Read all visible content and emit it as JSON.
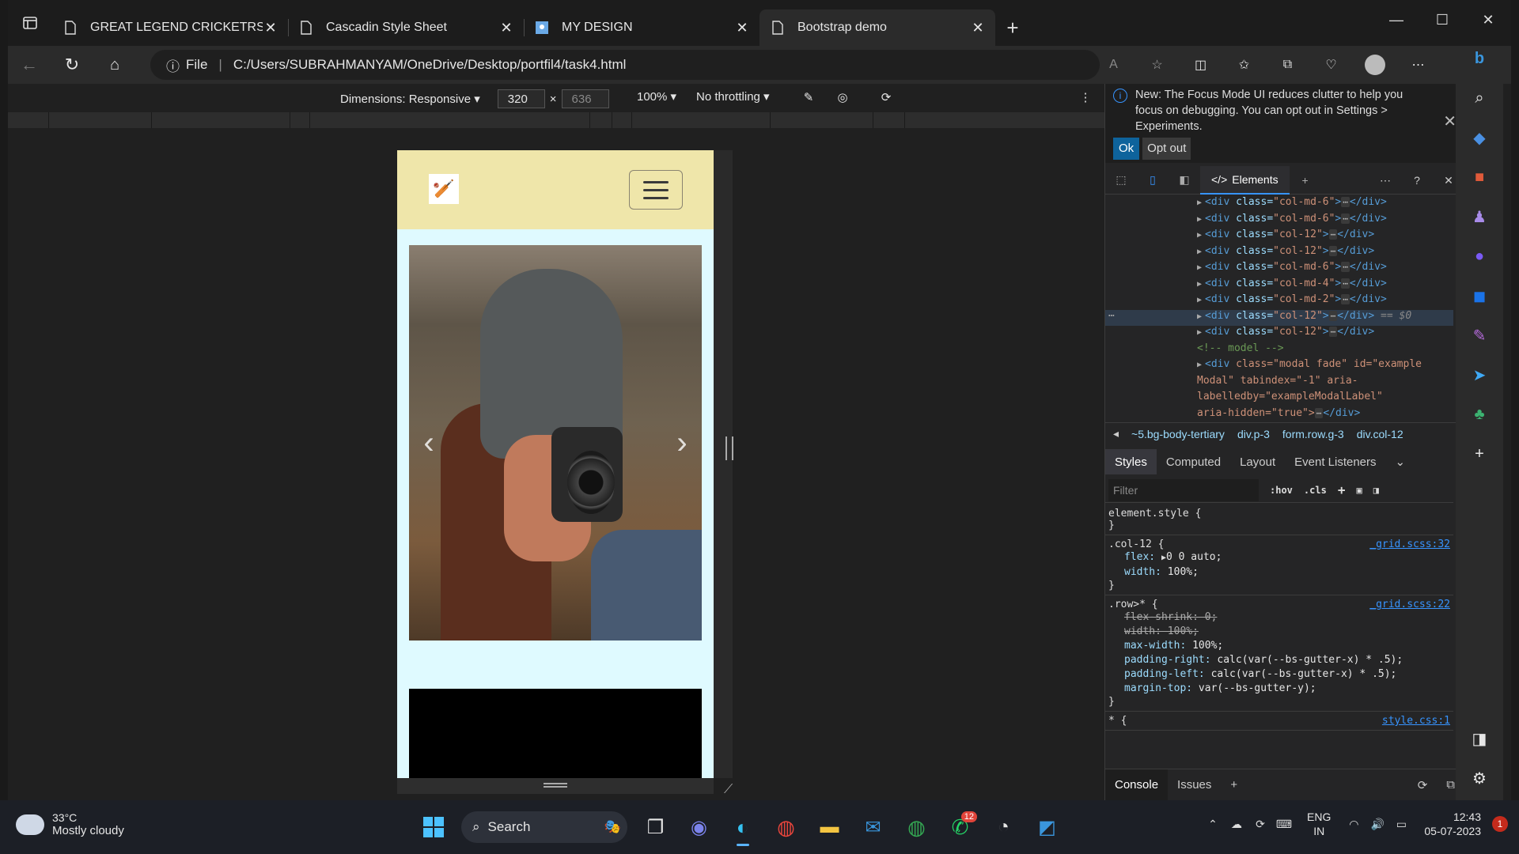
{
  "tabs": [
    {
      "title": "GREAT LEGEND CRICKETRS",
      "icon": "page-icon",
      "active": false
    },
    {
      "title": "Cascadin Style Sheet",
      "icon": "page-icon",
      "active": false
    },
    {
      "title": "MY DESIGN",
      "icon": "image-icon",
      "active": false
    },
    {
      "title": "Bootstrap demo",
      "icon": "page-icon",
      "active": true
    }
  ],
  "address": {
    "scheme": "File",
    "url": "C:/Users/SUBRAHMANYAM/OneDrive/Desktop/portfil4/task4.html"
  },
  "emulation": {
    "dimensions_label": "Dimensions: Responsive",
    "width": "320",
    "height": "636",
    "zoom": "100%",
    "throttling": "No throttling"
  },
  "devtools": {
    "notice": "New: The Focus Mode UI reduces clutter to help you focus on debugging. You can opt out in Settings > Experiments.",
    "ok_label": "Ok",
    "optout_label": "Opt out",
    "elements_tab": "Elements",
    "dom_lines": [
      {
        "tag": "div",
        "cls": "col-md-6"
      },
      {
        "tag": "div",
        "cls": "col-md-6"
      },
      {
        "tag": "div",
        "cls": "col-12"
      },
      {
        "tag": "div",
        "cls": "col-12"
      },
      {
        "tag": "div",
        "cls": "col-md-6"
      },
      {
        "tag": "div",
        "cls": "col-md-4"
      },
      {
        "tag": "div",
        "cls": "col-md-2"
      },
      {
        "tag": "div",
        "cls": "col-12"
      },
      {
        "tag": "div",
        "cls": "col-12"
      }
    ],
    "dom_selected_marker": "== $0",
    "dom_comment": "<!-- model -->",
    "modal_line_1": "class=\"modal fade\" id=\"example",
    "modal_line_2": "Modal\" tabindex=\"-1\" aria-",
    "modal_line_3": "labelledby=\"exampleModalLabel\"",
    "modal_line_4": "aria-hidden=\"true\">",
    "breadcrumbs": [
      "~5.bg-body-tertiary",
      "div.p-3",
      "form.row.g-3",
      "div.col-12"
    ],
    "style_tabs": [
      "Styles",
      "Computed",
      "Layout",
      "Event Listeners"
    ],
    "filter_placeholder": "Filter",
    "hov": ":hov",
    "cls": ".cls",
    "rules": {
      "element_style": "element.style {",
      "col12_selector": ".col-12 {",
      "col12_src": "_grid.scss:32",
      "col12_flex_p": "flex:",
      "col12_flex_v": "0 0 auto;",
      "col12_width_p": "width:",
      "col12_width_v": "100%;",
      "row_selector": ".row>* {",
      "row_src": "_grid.scss:22",
      "row_decl_1": "flex-shrink: 0;",
      "row_decl_2": "width: 100%;",
      "row_decl_3_p": "max-width:",
      "row_decl_3_v": "100%;",
      "row_decl_4_p": "padding-right:",
      "row_decl_4_v": "calc(var(--bs-gutter-x) * .5);",
      "row_decl_5_p": "padding-left:",
      "row_decl_5_v": "calc(var(--bs-gutter-x) * .5);",
      "row_decl_6_p": "margin-top:",
      "row_decl_6_v": "var(--bs-gutter-y);",
      "star_selector": "* {",
      "star_src": "style.css:1",
      "brace": "}"
    },
    "drawer_tabs": [
      "Console",
      "Issues"
    ]
  },
  "taskbar": {
    "temperature": "33°C",
    "weather": "Mostly cloudy",
    "search_label": "Search",
    "lang_1": "ENG",
    "lang_2": "IN",
    "time": "12:43",
    "date": "05-07-2023",
    "whatsapp_badge": "12",
    "notif_count": "1"
  },
  "colors": {
    "device_bg": "#dffaff",
    "device_nav": "#efe6aa",
    "accent": "#3794ff"
  }
}
